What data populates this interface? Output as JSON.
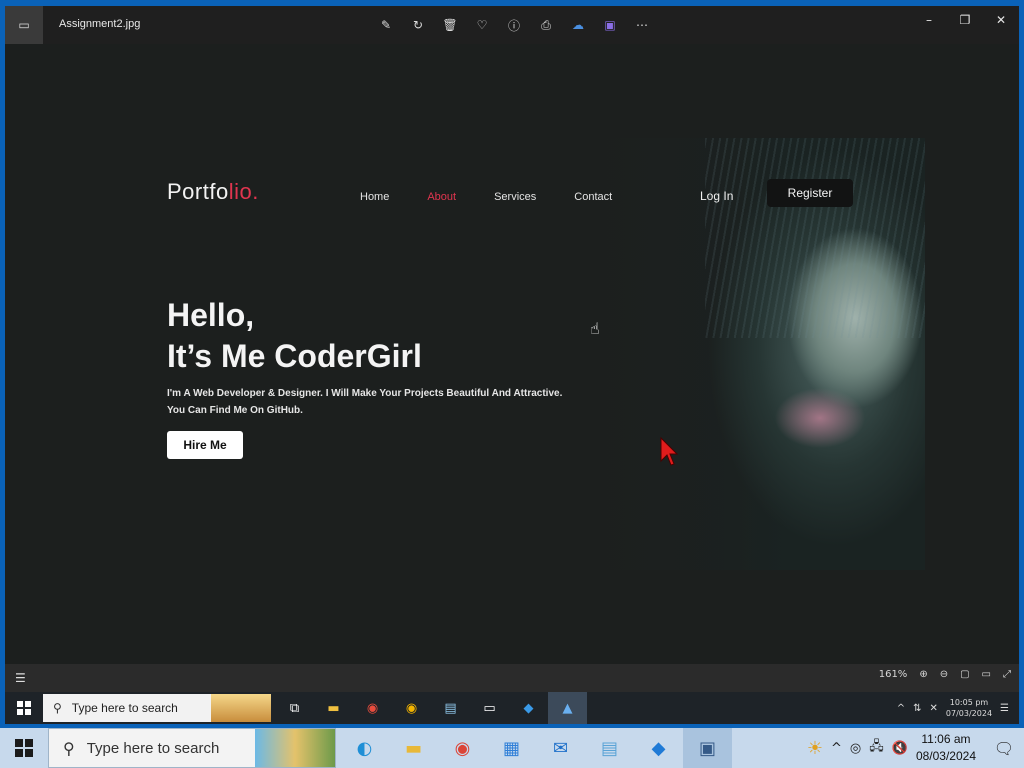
{
  "viewer": {
    "file_name": "Assignment2.jpg",
    "toolbar_icons": [
      "edit-image-icon",
      "rotate-icon",
      "delete-icon",
      "favorite-icon",
      "info-icon",
      "print-icon",
      "onedrive-icon",
      "clipchamp-icon",
      "more-icon"
    ],
    "zoom_level": "161%"
  },
  "portfolio": {
    "logo_main": "Portfo",
    "logo_accent": "lio.",
    "nav": [
      "Home",
      "About",
      "Services",
      "Contact"
    ],
    "active_nav": "About",
    "login": "Log In",
    "register": "Register",
    "greeting_line1": "Hello,",
    "greeting_line2": "It’s Me CoderGirl",
    "description_line1": "I'm A Web Developer & Designer. I Will Make Your Projects Beautiful And Attractive.",
    "description_line2": "You Can Find Me On GitHub.",
    "hire_button": "Hire Me",
    "accent_color": "#e0354f"
  },
  "inner_taskbar": {
    "search_placeholder": "Type here to search",
    "clock_time": "10:05 pm",
    "clock_date": "07/03/2024"
  },
  "host_taskbar": {
    "search_placeholder": "Type here to search",
    "clock_time": "11:06 am",
    "clock_date": "08/03/2024"
  }
}
